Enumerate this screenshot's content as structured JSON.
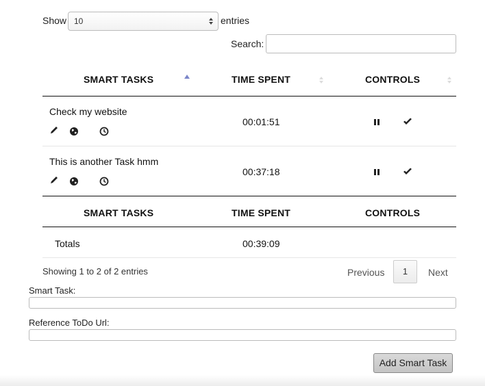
{
  "length_control": {
    "show_label": "Show",
    "selected": "10",
    "entries_label": "entries"
  },
  "search": {
    "label": "Search:",
    "value": ""
  },
  "table": {
    "columns": [
      "SMART TASKS",
      "TIME SPENT",
      "CONTROLS"
    ],
    "sort": {
      "column": "SMART TASKS",
      "direction": "ascending",
      "active_color": "#7b86c9"
    },
    "rows": [
      {
        "title": "Check my website",
        "time": "00:01:51",
        "icons": [
          "pencil-icon",
          "globe-icon",
          "clock-icon"
        ],
        "controls": [
          "pause-icon",
          "check-icon"
        ]
      },
      {
        "title": "This is another Task hmm",
        "time": "00:37:18",
        "icons": [
          "pencil-icon",
          "globe-icon",
          "clock-icon"
        ],
        "controls": [
          "pause-icon",
          "check-icon"
        ]
      }
    ],
    "footer_columns": [
      "SMART TASKS",
      "TIME SPENT",
      "CONTROLS"
    ],
    "totals": {
      "label": "Totals",
      "time": "00:39:09"
    }
  },
  "pagination": {
    "info": "Showing 1 to 2 of 2 entries",
    "previous": "Previous",
    "current_page": "1",
    "next": "Next"
  },
  "form": {
    "smart_task_label": "Smart Task:",
    "smart_task_value": "",
    "reference_label": "Reference ToDo Url:",
    "reference_value": "",
    "submit_label": "Add Smart Task"
  }
}
